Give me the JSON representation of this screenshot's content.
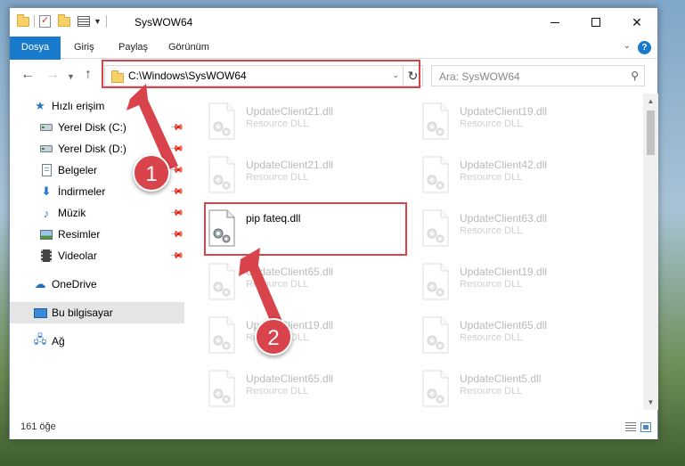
{
  "window": {
    "title": "SysWOW64"
  },
  "ribbon": {
    "file_tab": "Dosya",
    "tabs": [
      "Giriş",
      "Paylaş",
      "Görünüm"
    ],
    "help": "?"
  },
  "address": {
    "path": "C:\\Windows\\SysWOW64",
    "search_placeholder": "Ara: SysWOW64"
  },
  "sidebar": {
    "quick_access": "Hızlı erişim",
    "items": [
      "Yerel Disk (C:)",
      "Yerel Disk (D:)",
      "Belgeler",
      "İndirmeler",
      "Müzik",
      "Resimler",
      "Videolar"
    ],
    "onedrive": "OneDrive",
    "this_pc": "Bu bilgisayar",
    "network": "Ağ"
  },
  "files": [
    {
      "name": "UpdateClient21.dll",
      "type": "Resource DLL"
    },
    {
      "name": "UpdateClient19.dll",
      "type": "Resource DLL"
    },
    {
      "name": "UpdateClient21.dll",
      "type": "Resource DLL"
    },
    {
      "name": "UpdateClient42.dll",
      "type": "Resource DLL"
    },
    {
      "name": "pip fateq.dll",
      "type": ""
    },
    {
      "name": "UpdateClient63.dll",
      "type": "Resource DLL"
    },
    {
      "name": "UpdateClient65.dll",
      "type": "Resource DLL"
    },
    {
      "name": "UpdateClient19.dll",
      "type": "Resource DLL"
    },
    {
      "name": "UpdateClient19.dll",
      "type": "Resource DLL"
    },
    {
      "name": "UpdateClient65.dll",
      "type": "Resource DLL"
    },
    {
      "name": "UpdateClient65.dll",
      "type": "Resource DLL"
    },
    {
      "name": "UpdateClient5.dll",
      "type": "Resource DLL"
    }
  ],
  "status": {
    "item_count": "161 öğe"
  },
  "annotations": {
    "step1": "1",
    "step2": "2",
    "color": "#d9434b"
  }
}
